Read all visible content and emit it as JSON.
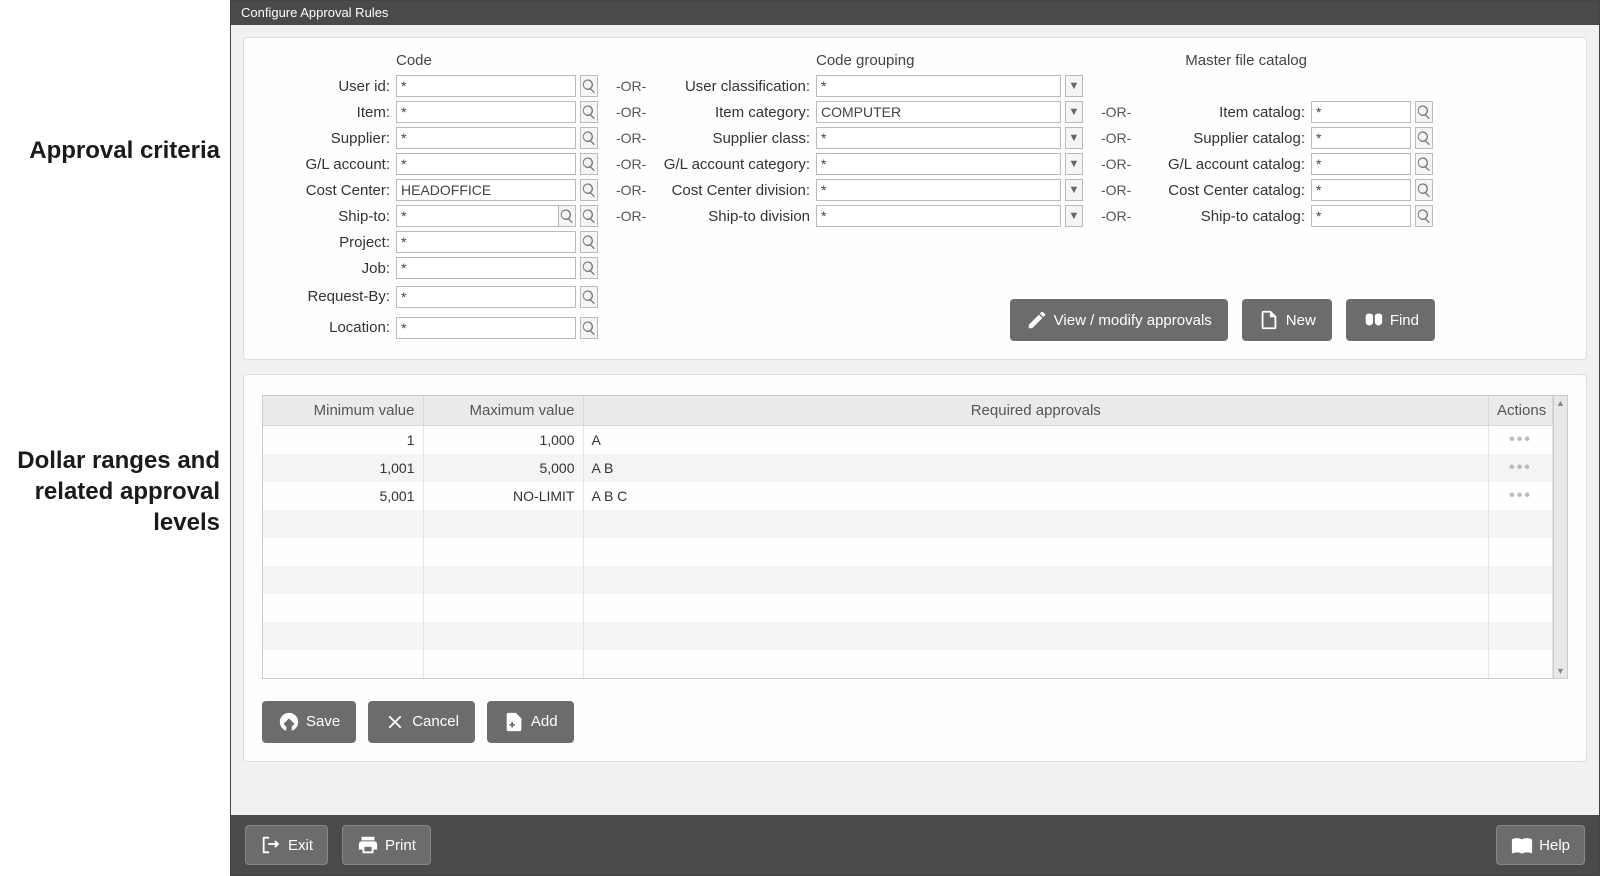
{
  "window": {
    "title": "Configure Approval Rules"
  },
  "callouts": {
    "criteria": "Approval criteria",
    "levels": "Dollar ranges and related approval levels"
  },
  "criteria": {
    "headers": {
      "code": "Code",
      "grouping": "Code grouping",
      "catalog": "Master file catalog"
    },
    "or_text": "-OR-",
    "code": {
      "user_id": {
        "label": "User id:",
        "value": "*"
      },
      "item": {
        "label": "Item:",
        "value": "*"
      },
      "supplier": {
        "label": "Supplier:",
        "value": "*"
      },
      "gl": {
        "label": "G/L account:",
        "value": "*"
      },
      "cost": {
        "label": "Cost Center:",
        "value": "HEADOFFICE"
      },
      "shipto": {
        "label": "Ship-to:",
        "value": "*"
      },
      "project": {
        "label": "Project:",
        "value": "*"
      },
      "job": {
        "label": "Job:",
        "value": "*"
      },
      "reqby": {
        "label": "Request-By:",
        "value": "*"
      },
      "location": {
        "label": "Location:",
        "value": "*"
      }
    },
    "grouping": {
      "user_class": {
        "label": "User classification:",
        "value": "*"
      },
      "item_cat": {
        "label": "Item category:",
        "value": "COMPUTER"
      },
      "supp_class": {
        "label": "Supplier class:",
        "value": "*"
      },
      "gl_cat": {
        "label": "G/L account category:",
        "value": "*"
      },
      "cost_div": {
        "label": "Cost Center division:",
        "value": "*"
      },
      "ship_div": {
        "label": "Ship-to division",
        "value": "*"
      }
    },
    "catalog": {
      "item": {
        "label": "Item catalog:",
        "value": "*"
      },
      "supp": {
        "label": "Supplier catalog:",
        "value": "*"
      },
      "gl": {
        "label": "G/L account catalog:",
        "value": "*"
      },
      "cost": {
        "label": "Cost Center catalog:",
        "value": "*"
      },
      "ship": {
        "label": "Ship-to catalog:",
        "value": "*"
      }
    },
    "buttons": {
      "view": "View / modify approvals",
      "new": "New",
      "find": "Find"
    }
  },
  "levels": {
    "columns": {
      "min": "Minimum value",
      "max": "Maximum value",
      "req": "Required approvals",
      "act": "Actions"
    },
    "rows": [
      {
        "min": "1",
        "max": "1,000",
        "req": "A"
      },
      {
        "min": "1,001",
        "max": "5,000",
        "req": "A B"
      },
      {
        "min": "5,001",
        "max": "NO-LIMIT",
        "req": "A B C"
      }
    ],
    "buttons": {
      "save": "Save",
      "cancel": "Cancel",
      "add": "Add"
    }
  },
  "footer": {
    "exit": "Exit",
    "print": "Print",
    "help": "Help"
  }
}
